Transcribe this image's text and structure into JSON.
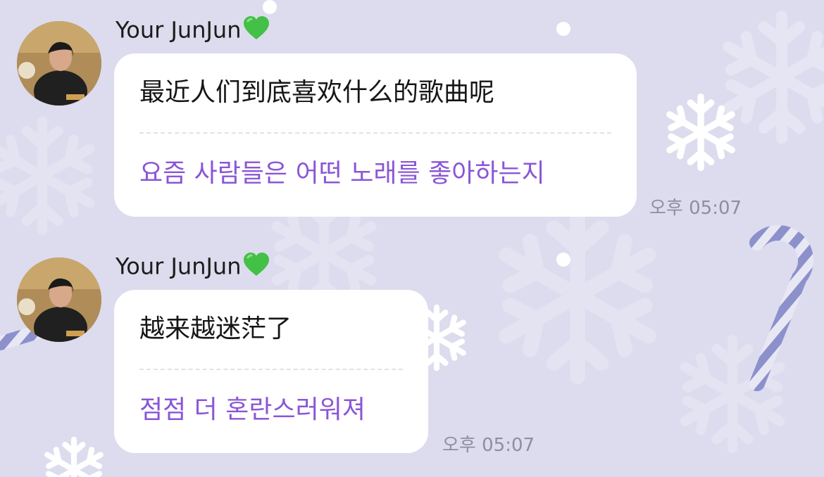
{
  "messages": [
    {
      "sender": "Your JunJun",
      "text_zh": "最近人们到底喜欢什么的歌曲呢",
      "text_ko": "요즘 사람들은 어떤 노래를 좋아하는지",
      "time": "오후 05:07"
    },
    {
      "sender": "Your JunJun",
      "text_zh": "越来越迷茫了",
      "text_ko": "점점 더 혼란스러워져",
      "time": "오후 05:07"
    }
  ],
  "colors": {
    "background": "#dcdcee",
    "bubble": "#ffffff",
    "translation_text": "#8a56d6",
    "timestamp": "#8e8e9c",
    "heart": "#43c046"
  },
  "icons": {
    "heart": "green-heart-emoji",
    "decor": [
      "snowflake",
      "candy-cane"
    ]
  }
}
